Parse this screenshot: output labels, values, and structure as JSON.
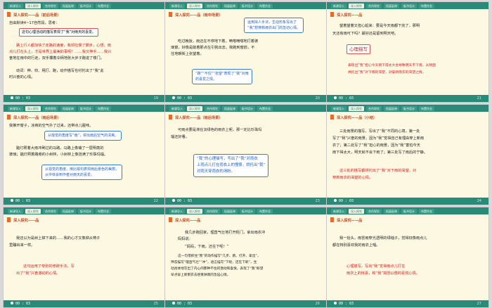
{
  "nav_tabs": [
    "新课导入",
    "深入探究",
    "合作探究",
    "拓展延伸",
    "板书设计",
    "布置作业"
  ],
  "slides": [
    {
      "num": "19",
      "timer": "00 : 03",
      "title": "深入探究——品（前后场景）",
      "lines": [
        "自由默读4~17自然段，思考：",
        "这句心理活动的描写表现了“我”对雨天的喜爱。",
        "路上行人都加快了走路的速度，我却捡慢了脚步，心想，雨",
        "点儿打在头上，才是世界上最美的事呢！……我又伸手……我兴",
        "奋地在雨中的行走，双手攥着伞柄地张大步子跑进了楼门。",
        "动词：伸、仰、甩打、跑，动作描写也衬托出了“我”此",
        "时兴奋的心情。"
      ]
    },
    {
      "num": "20",
      "timer": "00 : 03",
      "title": "深入探究——品（雨中场景）",
      "lines": [
        "运用拟人手法，生动形象写出了",
        "“我”想穿新雨衣出门的急切心情。",
        "吃过晚饭，雨还在不停地下着，嘀嗒嘀嗒地打着玻",
        "璃窗，好像是敲着那点在引我出去。我跑到窗前，不",
        "住地朝街上张望着。",
        "“跑”“不住”“张望”表现了“我”对雨",
        "的喜爱之情。"
      ]
    },
    {
      "num": "21",
      "timer": "00 : 03",
      "title": "深入探究——品",
      "lines": [
        "望着望着又担心起来：要是今天雨都下完了，那明",
        "天还有雨可下吗？最好还是留到明天吧。",
        "心理描写",
        "表现出“我”担心今天雨下得太大会导致明天不下雨，从侧面",
        "烘托出“我”对下雨的渴望，对穿新雨衣的渴望之情。"
      ]
    },
    {
      "num": "22",
      "timer": "00 : 03",
      "title": "深入探究——品（雨后场景）",
      "lines": [
        "我推开窗子，凉爽的空气扑了过来，还带点儿腥味。",
        "从嗅觉的角度写“雨”，突出雨后空气的清爽。",
        "踮灯照着大雨冲刷过的马路，马路上像铺了一层明亮的",
        "玻璃；踮灯照着路旁的小树林，小树林上像挂满了珍珠玛瑙。",
        "从视觉的角度，用比喻句表现雨后景色的美丽，",
        "从中体会到作者对雨天的喜爱。"
      ]
    },
    {
      "num": "23",
      "timer": "00 : 03",
      "title": "深入探究——品（雨后场景）",
      "lines": [
        "可雨点要是淋在淡绿色的雨衣上呢，那一定比珍珠玛",
        "瑙还好看。",
        "“我”的心理描写，写出了“我”对雨衣",
        "上雨点儿打在雨衣上的憧憬，烘托出“我”",
        "对雨天穿雨衣的渴盼。"
      ]
    },
    {
      "num": "24",
      "timer": "00 : 03",
      "title": "深入探究——品（小结）",
      "lines": [
        "三处雨景的描写，写出了“我”不同的心境，第一处",
        "写了“我”兴奋的雨景，因为“我”觉得自己有理由穿上新雨",
        "衣了；第二处写了“我”担心的雨景，因为“我”害怕今天",
        "雨下得太大，明天就不会下雨了；第三处写了雨后的宁静。",
        "这三处的描写都烘托出了“我”对下雨的渴望，对",
        "穿新雨衣的渴望的心情。"
      ]
    },
    {
      "num": "25",
      "timer": "00 : 03",
      "title": "深入探究——品",
      "lines": [
        "我还以为是树上掉下来的……我的心才又像掉从椅子",
        "里蹦出来一样。",
        "这句运用了夸张的修辞手法，写",
        "出了“我”兴奋激动的心情。"
      ]
    },
    {
      "num": "26",
      "timer": "00 : 03",
      "title": "深入探究——品",
      "lines": [
        "我几步跑回家，理直气壮地打开柜门，拿出雨衣冲",
        "妈妈说：",
        "“妈妈，下雨，还在下呢！”",
        "这一句借抓住“我”的动作描写“几步、跑、打开、拿出”，",
        "神态描写“理直气壮”“冲”，语言描写“下呢，还在下呢”，生",
        "动具体地写出了内心的那种不住的激动和喜悦，表现了“我”盼望",
        "早点穿上新雨衣去感受淋雨的急迫心情。"
      ]
    },
    {
      "num": "27",
      "timer": "00 : 03",
      "title": "深入探究——品",
      "lines": [
        "我一抬头，雨冒雨穿光透明的绿袖子，觉得好像雨点儿",
        "都在特别喜欢我的雨衣上唱。",
        "心理描写，写出“我”觉得雨点儿打在",
        "雨衣上的惊喜，和“我”如愿以偿的喜悦心情。"
      ]
    }
  ]
}
